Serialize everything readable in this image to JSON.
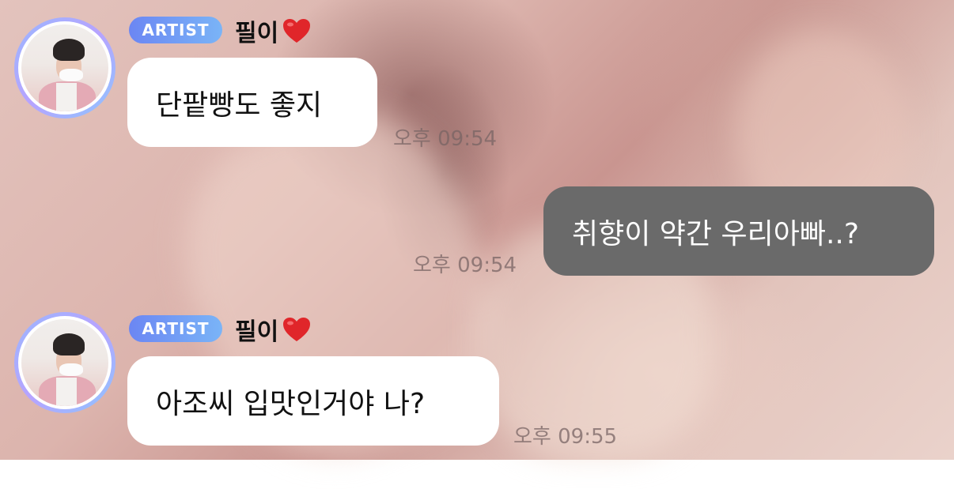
{
  "chat": {
    "messages": [
      {
        "sender": {
          "badge": "ARTIST",
          "name": "필이"
        },
        "text": "단팥빵도 좋지",
        "time": "오후 09:54"
      },
      {
        "sender": null,
        "text": "취향이 약간 우리아빠..?",
        "time": "오후 09:54"
      },
      {
        "sender": {
          "badge": "ARTIST",
          "name": "필이"
        },
        "text": "아조씨 입맛인거야 나?",
        "time": "오후 09:55"
      }
    ]
  },
  "icons": {
    "heart": "heart-icon",
    "avatar": "artist-avatar"
  },
  "colors": {
    "badge_gradient_start": "#6b86f3",
    "badge_gradient_end": "#7ab4f7",
    "incoming_bubble": "#ffffff",
    "outgoing_bubble": "#6a6a6a",
    "heart": "#e0262a"
  }
}
